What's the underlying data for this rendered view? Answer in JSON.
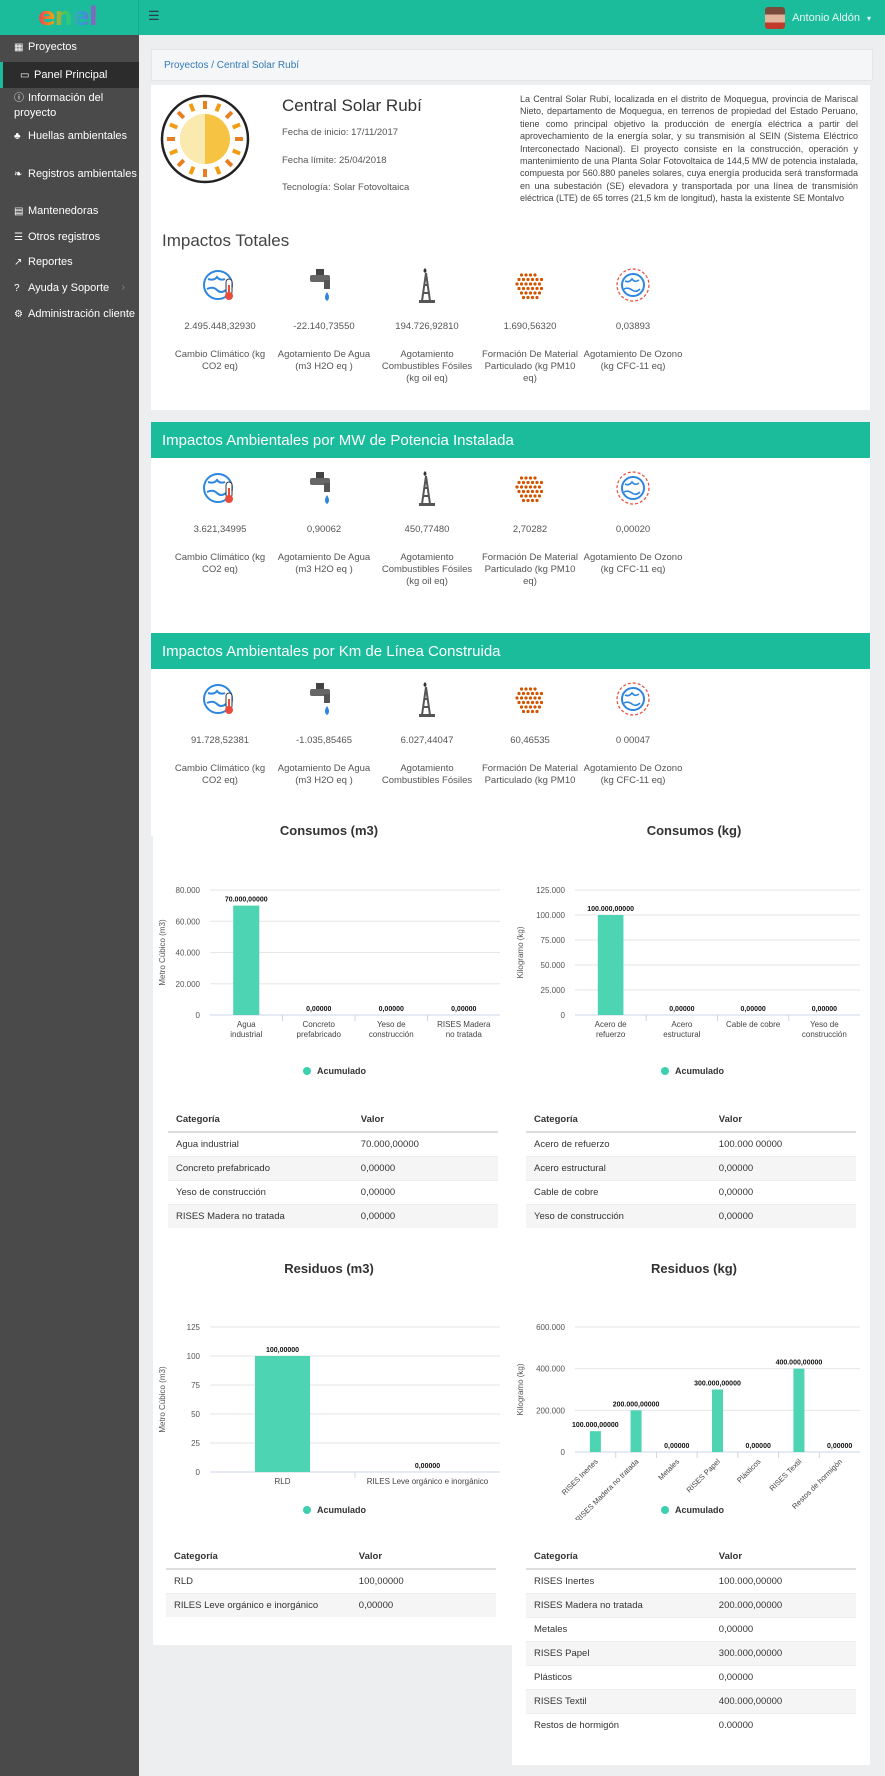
{
  "header": {
    "logo_text": "enel",
    "user_name": "Antonio Aldón"
  },
  "sidebar": {
    "items": [
      {
        "icon": "grid-icon",
        "label": "Proyectos"
      },
      {
        "icon": "monitor-icon",
        "label": "Panel Principal",
        "active": true
      },
      {
        "icon": "info-icon",
        "label": "Información del proyecto"
      },
      {
        "icon": "paw-icon",
        "label": "Huellas ambientales",
        "chevron": true
      },
      {
        "icon": "leaf-icon",
        "label": "Registros ambientales"
      },
      {
        "icon": "table-icon",
        "label": "Mantenedoras"
      },
      {
        "icon": "list-icon",
        "label": "Otros registros"
      },
      {
        "icon": "chart-line-icon",
        "label": "Reportes"
      },
      {
        "icon": "question-icon",
        "label": "Ayuda y Soporte",
        "chevron": true
      },
      {
        "icon": "gears-icon",
        "label": "Administración cliente",
        "chevron": true
      }
    ]
  },
  "breadcrumb": "Proyectos / Central Solar Rubí",
  "project": {
    "name": "Central Solar Rubí",
    "start": "Fecha de inicio: 17/11/2017",
    "deadline": "Fecha límite: 25/04/2018",
    "technology": "Tecnología: Solar Fotovoltaica",
    "description": "La Central Solar Rubí, localizada en el distrito de Moquegua, provincia de Mariscal Nieto, departamento de Moquegua, en terrenos de propiedad del Estado Peruano, tiene como principal objetivo la producción de energía eléctrica a partir del aprovechamiento de la energía solar, y su transmisión al SEIN (Sistema Eléctrico Interconectado Nacional). El proyecto consiste en la construcción, operación y mantenimiento de una Planta Solar Fotovoltaica de 144,5 MW de potencia instalada, compuesta por 560.880 paneles solares, cuya energía producida será transformada en una subestación (SE) elevadora y transportada por una línea de transmisión eléctrica (LTE) de 65 torres (21,5 km de longitud), hasta la existente SE Montalvo"
  },
  "impacts_total": {
    "title": "Impactos Totales",
    "items": [
      {
        "icon": "globe-thermometer-icon",
        "value": "2.495.448,32930",
        "label": "Cambio Climático (kg CO2 eq)"
      },
      {
        "icon": "water-tap-icon",
        "value": "-22.140,73550",
        "label": "Agotamiento De Agua (m3 H2O eq )"
      },
      {
        "icon": "oil-rig-icon",
        "value": "194.726,92810",
        "label": "Agotamiento Combustibles Fósiles (kg oil eq)"
      },
      {
        "icon": "particles-icon",
        "value": "1.690,56320",
        "label": "Formación De Material Particulado (kg PM10 eq)"
      },
      {
        "icon": "ozone-globe-icon",
        "value": "0,03893",
        "label": "Agotamiento De Ozono (kg CFC-11 eq)"
      }
    ]
  },
  "impacts_mw": {
    "title": "Impactos Ambientales por MW de Potencia Instalada",
    "items": [
      {
        "icon": "globe-thermometer-icon",
        "value": "3.621,34995",
        "label": "Cambio Climático (kg CO2 eq)"
      },
      {
        "icon": "water-tap-icon",
        "value": "0,90062",
        "label": "Agotamiento De Agua (m3 H2O eq )"
      },
      {
        "icon": "oil-rig-icon",
        "value": "450,77480",
        "label": "Agotamiento Combustibles Fósiles (kg oil eq)"
      },
      {
        "icon": "particles-icon",
        "value": "2,70282",
        "label": "Formación De Material Particulado (kg PM10 eq)"
      },
      {
        "icon": "ozone-globe-icon",
        "value": "0,00020",
        "label": "Agotamiento De Ozono (kg CFC-11 eq)"
      }
    ]
  },
  "impacts_km": {
    "title": "Impactos Ambientales por Km de Línea Construida",
    "items": [
      {
        "icon": "globe-thermometer-icon",
        "value": "91.728,52381",
        "label": "Cambio Climático (kg CO2 eq)"
      },
      {
        "icon": "water-tap-icon",
        "value": "-1.035,85465",
        "label": "Agotamiento De Agua (m3 H2O eq )"
      },
      {
        "icon": "oil-rig-icon",
        "value": "6.027,44047",
        "label": "Agotamiento Combustibles Fósiles"
      },
      {
        "icon": "particles-icon",
        "value": "60,46535",
        "label": "Formación De Material Particulado (kg PM10"
      },
      {
        "icon": "ozone-globe-icon",
        "value": "0 00047",
        "label": "Agotamiento De Ozono (kg CFC-11 eq)"
      }
    ]
  },
  "chart_data": [
    {
      "id": "cons_m3",
      "type": "bar",
      "title": "Consumos (m3)",
      "ylabel": "Metro Cúbico (m3)",
      "ylim": [
        0,
        80000
      ],
      "ticks": [
        "0",
        "20.000",
        "40.000",
        "60.000",
        "80.000"
      ],
      "tick_values": [
        0,
        20000,
        40000,
        60000,
        80000
      ],
      "categories": [
        "Agua industrial",
        "Concreto prefabricado",
        "Yeso de construcción",
        "RISES Madera no tratada"
      ],
      "values": [
        70000,
        0,
        0,
        0
      ],
      "data_labels": [
        "70.000,00000",
        "0,00000",
        "0,00000",
        "0,00000"
      ],
      "series": [
        {
          "name": "Acumulado"
        }
      ],
      "legend": "bottom"
    },
    {
      "id": "cons_kg",
      "type": "bar",
      "title": "Consumos (kg)",
      "ylabel": "Kilogramo (kg)",
      "ylim": [
        0,
        125000
      ],
      "ticks": [
        "0",
        "25.000",
        "50.000",
        "75.000",
        "100.000",
        "125.000"
      ],
      "tick_values": [
        0,
        25000,
        50000,
        75000,
        100000,
        125000
      ],
      "categories": [
        "Acero de refuerzo",
        "Acero estructural",
        "Cable de cobre",
        "Yeso de construcción"
      ],
      "values": [
        100000,
        0,
        0,
        0
      ],
      "data_labels": [
        "100.000,00000",
        "0,00000",
        "0,00000",
        "0,00000"
      ],
      "series": [
        {
          "name": "Acumulado"
        }
      ],
      "legend": "bottom"
    },
    {
      "id": "res_m3",
      "type": "bar",
      "title": "Residuos (m3)",
      "ylabel": "Metro Cúbico (m3)",
      "ylim": [
        0,
        125
      ],
      "ticks": [
        "0",
        "25",
        "50",
        "75",
        "100",
        "125"
      ],
      "tick_values": [
        0,
        25,
        50,
        75,
        100,
        125
      ],
      "categories": [
        "RLD",
        "RILES Leve orgánico e inorgánico"
      ],
      "values": [
        100,
        0
      ],
      "data_labels": [
        "100,00000",
        "0,00000"
      ],
      "series": [
        {
          "name": "Acumulado"
        }
      ],
      "legend": "bottom"
    },
    {
      "id": "res_kg",
      "type": "bar",
      "title": "Residuos (kg)",
      "ylabel": "Kilogramo (kg)",
      "ylim": [
        0,
        600000
      ],
      "ticks": [
        "0",
        "200.000",
        "400.000",
        "600.000"
      ],
      "tick_values": [
        0,
        200000,
        400000,
        600000
      ],
      "categories": [
        "RISES Inertes",
        "RISES Madera no tratada",
        "Metales",
        "RISES Papel",
        "Plásticos",
        "RISES Textil",
        "Restos de hormigón"
      ],
      "values": [
        100000,
        200000,
        0,
        300000,
        0,
        400000,
        0
      ],
      "data_labels": [
        "100.000,00000",
        "200.000,00000",
        "0,00000",
        "300.000,00000",
        "0,00000",
        "400.000,00000",
        "0,00000"
      ],
      "series": [
        {
          "name": "Acumulado"
        }
      ],
      "legend": "bottom"
    }
  ],
  "tables": {
    "headers": {
      "cat": "Categoría",
      "val": "Valor"
    },
    "cons_m3": [
      [
        "Agua industrial",
        "70.000,00000"
      ],
      [
        "Concreto prefabricado",
        "0,00000"
      ],
      [
        "Yeso de construcción",
        "0,00000"
      ],
      [
        "RISES Madera no tratada",
        "0,00000"
      ]
    ],
    "cons_kg": [
      [
        "Acero de refuerzo",
        "100.000 00000"
      ],
      [
        "Acero estructural",
        "0,00000"
      ],
      [
        "Cable de cobre",
        "0,00000"
      ],
      [
        "Yeso de construcción",
        "0,00000"
      ]
    ],
    "res_m3": [
      [
        "RLD",
        "100,00000"
      ],
      [
        "RILES Leve orgánico e inorgánico",
        "0,00000"
      ]
    ],
    "res_kg": [
      [
        "RISES Inertes",
        "100.000,00000"
      ],
      [
        "RISES Madera no tratada",
        "200.000,00000"
      ],
      [
        "Metales",
        "0,00000"
      ],
      [
        "RISES Papel",
        "300.000,00000"
      ],
      [
        "Plásticos",
        "0,00000"
      ],
      [
        "RISES Textil",
        "400.000,00000"
      ],
      [
        "Restos de hormigón",
        "0.00000"
      ]
    ]
  }
}
